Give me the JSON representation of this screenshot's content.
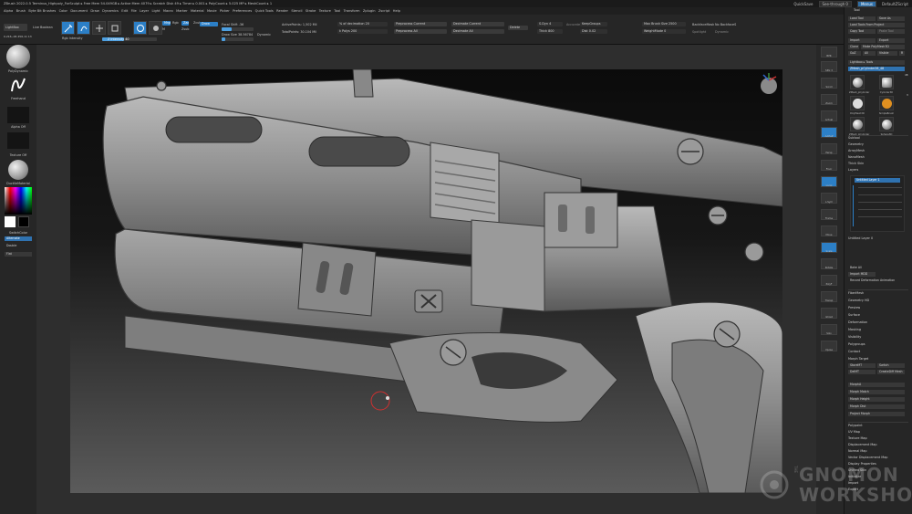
{
  "title_bar": {
    "text": "ZBrush 2022.0.5    Terminus_Highpoly_ForSculpt    ▸ Free Mem 54.049GB ▸ Active Mem 4079 ▸ Scratch Disk 49 ▸ Timer ▸ 0.001 ▸ PolyCount ▸ 5.025 MP ▸ MeshCount ▸ 1",
    "quicksave": "QuickSave",
    "see_through": "See-through 0",
    "menus_label": "Menus",
    "default_script": "DefaultZScript"
  },
  "menu_bar": [
    "Alpha",
    "Brush",
    "Byte Bit Brushes",
    "Color",
    "Document",
    "Draw",
    "Dynamics",
    "Edit",
    "File",
    "Layer",
    "Light",
    "Macro",
    "Marker",
    "Material",
    "Movie",
    "Picker",
    "Preferences",
    "Quick Tools",
    "Render",
    "Stencil",
    "Stroke",
    "Texture",
    "Tool",
    "Transform",
    "Zplugin",
    "Zscript",
    "Help"
  ],
  "shelf": {
    "lightbox": "LightBox",
    "live_boolean": "Live Boolean",
    "coords": "0.216,-06 456,11 13",
    "mrgb": "Mrgb",
    "rgb": "Rgb",
    "m_label": "M",
    "zadd": "Zadd",
    "zsub": "Zsub",
    "zcut": "Zcut",
    "rgb_intensity": "Rgb Intensity",
    "z_intensity": "Z Intensity 40",
    "focal_shift": "Focal Shift -36",
    "draw_size": "Draw Size 38.56784",
    "dynamic": "Dynamic",
    "active_points": "ActivePoints: 1,502 Mil",
    "total_points": "TotalPoints: 30.104 Mil",
    "decimation": "% of decimation 20",
    "k_polys": "k Polys 200",
    "preprocess_current": "Preprocess Current",
    "preprocess_all": "Preprocess All",
    "decimate_current": "Decimate Current",
    "decimate_all": "Decimate All",
    "delete": "Delete",
    "s_dyn": "S.Dyn 4",
    "thick": "Thick 800",
    "keep_groups": "KeepGroups",
    "dist": "Dist 0.02",
    "accurate": "Accurate",
    "max_brush_size": "Max Brush Size 2500",
    "weightmode": "WeightMode 0",
    "backface_mask": "BackfaceMask",
    "no_backfaces": "No BackfaceS",
    "spotlight": "Spotlight",
    "dynamic_2": "Dynamic"
  },
  "left_tray": {
    "brush_name": "PolyDynamic",
    "stroke_name": "Freehand",
    "alpha_label": "Alpha Off",
    "texture_label": "Texture Off",
    "material_label": "DuctileMaterial",
    "switch_color": "SwitchColor",
    "alternate": "Alternate",
    "double": "Double",
    "flat": "Flat"
  },
  "right_icons": [
    "BPR",
    "SPix 3",
    "Scroll",
    "Zoom",
    "Actual",
    "AAHalf",
    "Persp",
    "Floor",
    "Local",
    "L.Sym",
    "Frame",
    "Move",
    "Scale",
    "Rotate",
    "PolyF",
    "Transp",
    "Ghost",
    "Solo",
    "Xpose"
  ],
  "right_tray": {
    "header": "Tool",
    "load_tool": "Load Tool",
    "save_as": "Save As",
    "load_tools_from_project": "Load Tools From Project",
    "copy_tool": "Copy Tool",
    "paste_tool": "Paste Tool",
    "import": "Import",
    "export": "Export",
    "clone": "Clone",
    "make_polymesh3d": "Make PolyMesh3D",
    "goz": "GoZ",
    "all": "All",
    "visible": "Visible",
    "r_label": "R",
    "lightbox_tools": "Lightbox ▸ Tools",
    "current_tool": "ZMesh_pCylinder26_48",
    "tool_thumbs": [
      "ZMesh_pCylinder",
      "Cylinder3D",
      "PolyMesh3D",
      "SimpleBrush",
      "ZMesh_pCylinder",
      "Sphere3D"
    ],
    "count_a": "48",
    "count_b": "3",
    "subtool": "Subtool",
    "geometry": "Geometry",
    "arraymesh": "ArrayMesh",
    "nanomesh": "NanoMesh",
    "thick_skin": "Thick Skin",
    "layers": "Layers",
    "layer_name": "Untitled Layer 1",
    "layer_name_2": "Untitled Layer 0",
    "bake_all": "Bake All",
    "import_mdd": "Import MDD",
    "record_deformation": "Record Deformation Animation",
    "sections": [
      "FiberMesh",
      "Geometry HD",
      "Preview",
      "Surface",
      "Deformation",
      "Masking",
      "Visibility",
      "Polygroups",
      "Contact",
      "Morph Target"
    ],
    "storemt": "StoreMT",
    "delmt": "DelMT",
    "switch": "Switch",
    "createdifffmesh": "CreateDiff Mesh",
    "morph_rows": [
      "MorphA",
      "Morph Match",
      "Morph Height",
      "Morph Dist",
      "Project Morph"
    ],
    "sections_2": [
      "Polypaint",
      "UV Map",
      "Texture Map",
      "Displacement Map",
      "Normal Map",
      "Vector Displacement Map",
      "Display Properties",
      "Unified Skin",
      "Initialize",
      "Import",
      "Export"
    ]
  },
  "watermark": {
    "the": "THE",
    "line1": "GNOMON",
    "line2": "WORKSHOP"
  },
  "colors": {
    "accent": "#2c7fc6",
    "slider_fill": "#4d9fe0",
    "panel": "#262626",
    "canvas_top": "#0b0b0b",
    "canvas_bottom": "#5b5b5b"
  }
}
